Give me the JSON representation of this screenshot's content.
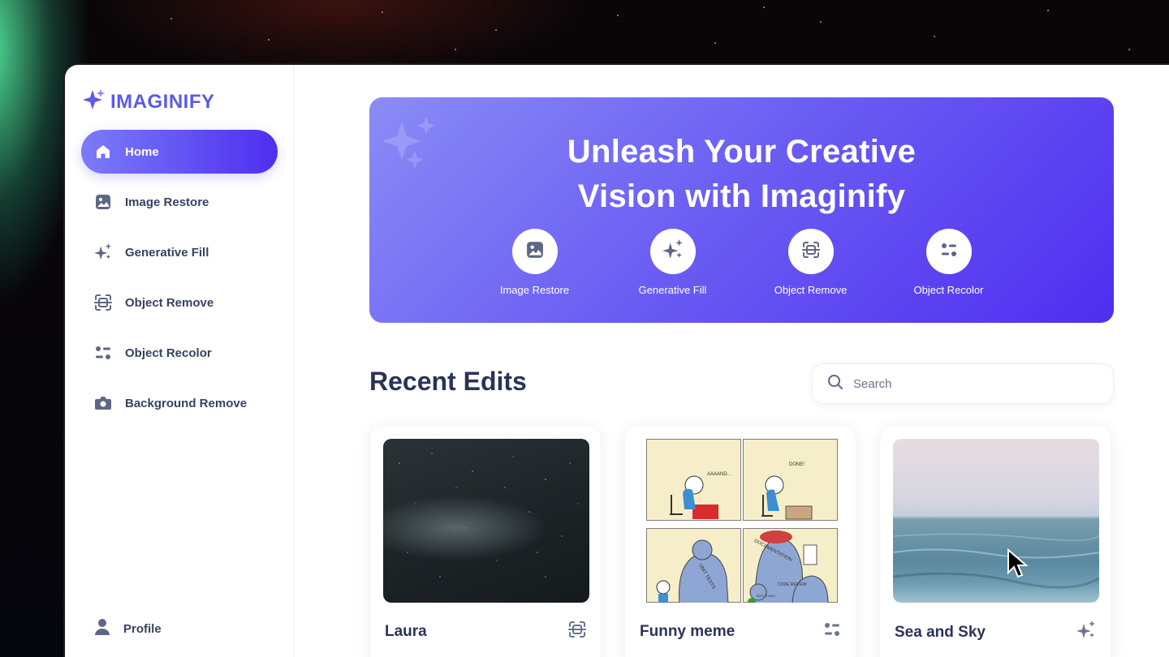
{
  "app": {
    "name": "IMAGINIFY"
  },
  "sidebar": {
    "items": [
      {
        "label": "Home",
        "icon": "home-icon",
        "active": true
      },
      {
        "label": "Image Restore",
        "icon": "image-icon",
        "active": false
      },
      {
        "label": "Generative Fill",
        "icon": "sparkles-icon",
        "active": false
      },
      {
        "label": "Object Remove",
        "icon": "scan-icon",
        "active": false
      },
      {
        "label": "Object Recolor",
        "icon": "filter-icon",
        "active": false
      },
      {
        "label": "Background Remove",
        "icon": "camera-icon",
        "active": false
      }
    ],
    "profile_label": "Profile"
  },
  "banner": {
    "title_line1": "Unleash Your Creative",
    "title_line2": "Vision with Imaginify",
    "quick_links": [
      {
        "label": "Image Restore",
        "icon": "image-icon"
      },
      {
        "label": "Generative Fill",
        "icon": "sparkles-icon"
      },
      {
        "label": "Object Remove",
        "icon": "scan-icon"
      },
      {
        "label": "Object Recolor",
        "icon": "filter-icon"
      }
    ]
  },
  "recent": {
    "title": "Recent Edits",
    "search_placeholder": "Search",
    "cards": [
      {
        "title": "Laura",
        "transformation_icon": "scan-icon"
      },
      {
        "title": "Funny meme",
        "transformation_icon": "filter-icon"
      },
      {
        "title": "Sea and Sky",
        "transformation_icon": "sparkles-icon"
      }
    ]
  },
  "comic": {
    "panel1_text": "AAAAND...",
    "panel2_text": "DONE!",
    "panel3_text": "UNIT TESTS",
    "panel4_text1": "DOCUMENTATION",
    "panel4_text2": "CODE REVIEW",
    "panel4_text3": "BUG FIXING"
  },
  "colors": {
    "accent": "#5b5be6",
    "banner_start": "#8a8cf6",
    "banner_end": "#4f2ef0",
    "text_dark": "#2b3357",
    "text_nav": "#384262"
  }
}
